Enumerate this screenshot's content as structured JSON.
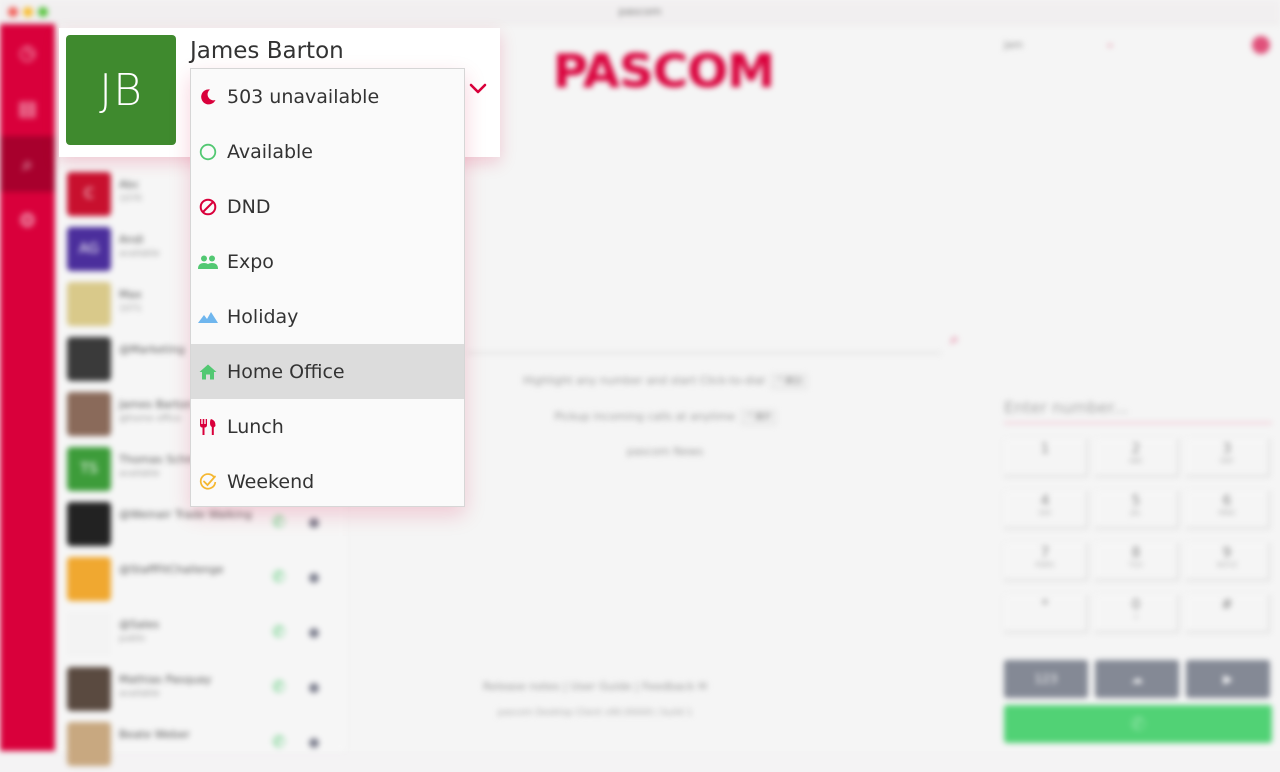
{
  "window": {
    "title": "pascom",
    "traffic_lights": [
      "#f25f58",
      "#f9bd2e",
      "#56c43c"
    ]
  },
  "sidebar": {
    "items": [
      {
        "name": "dashboard",
        "icon": "clock-icon"
      },
      {
        "name": "contacts",
        "icon": "address-card-icon"
      },
      {
        "name": "search",
        "icon": "search-icon",
        "active": true
      },
      {
        "name": "settings",
        "icon": "gear-icon"
      }
    ]
  },
  "user": {
    "initials": "JB",
    "name": "James Barton",
    "avatar_color": "#3f8a2e"
  },
  "status_dropdown": {
    "options": [
      {
        "label": "503 unavailable",
        "icon": "moon-icon",
        "color": "#d9003b"
      },
      {
        "label": "Available",
        "icon": "circle-outline-icon",
        "color": "#52c872"
      },
      {
        "label": "DND",
        "icon": "prohibited-icon",
        "color": "#d9003b"
      },
      {
        "label": "Expo",
        "icon": "people-icon",
        "color": "#52c872"
      },
      {
        "label": "Holiday",
        "icon": "mountain-icon",
        "color": "#6fb6ee"
      },
      {
        "label": "Home Office",
        "icon": "home-icon",
        "color": "#52c872",
        "highlighted": true
      },
      {
        "label": "Lunch",
        "icon": "cutlery-icon",
        "color": "#d9003b"
      },
      {
        "label": "Weekend",
        "icon": "check-circle-icon",
        "color": "#f5b730"
      }
    ]
  },
  "contacts": [
    {
      "initials": "C",
      "name": "Abc",
      "sub": "1070",
      "color": "#c8102e"
    },
    {
      "initials": "AG",
      "name": "Andi",
      "sub": "available",
      "color": "#4b2e9c"
    },
    {
      "initials": "",
      "name": "Max",
      "sub": "1071",
      "color": "#d9c98a"
    },
    {
      "initials": "",
      "name": "@Marketing",
      "sub": "",
      "color": "#3a3a3a"
    },
    {
      "initials": "",
      "name": "James Barton",
      "sub": "@home office",
      "color": "#8a6a5a"
    },
    {
      "initials": "TS",
      "name": "Thomas Schmidt",
      "sub": "available",
      "color": "#3d9c3a"
    },
    {
      "initials": "",
      "name": "@Weinair Trade Walking",
      "sub": "",
      "color": "#222"
    },
    {
      "initials": "",
      "name": "@StaffFitChallenge",
      "sub": "",
      "color": "#f0a830"
    },
    {
      "initials": "",
      "name": "@Sales",
      "sub": "public",
      "color": "#f3f3f3"
    },
    {
      "initials": "",
      "name": "Mathias Pasquay",
      "sub": "available",
      "color": "#5a4a40"
    },
    {
      "initials": "",
      "name": "Beate Weber",
      "sub": "",
      "color": "#c8a880"
    }
  ],
  "main": {
    "logo": "PASCOM",
    "hints": [
      {
        "text": "Highlight any number and start Click-to-dial",
        "key": "⌃⌘D"
      },
      {
        "text": "Pickup incoming calls at anytime",
        "key": "⌃⌘P"
      },
      {
        "text": "pascom News",
        "key": ""
      }
    ],
    "footer_links": "Release notes  |  User Guide  |  Feedback ✉",
    "footer_version": "pascom Desktop Client v90.00000 / build 1"
  },
  "right_panel": {
    "user_label": "Jam",
    "number_placeholder": "Enter number...",
    "keys": [
      {
        "digit": "1",
        "letters": ""
      },
      {
        "digit": "2",
        "letters": "ABC"
      },
      {
        "digit": "3",
        "letters": "DEF"
      },
      {
        "digit": "4",
        "letters": "GHI"
      },
      {
        "digit": "5",
        "letters": "JKL"
      },
      {
        "digit": "6",
        "letters": "MNO"
      },
      {
        "digit": "7",
        "letters": "PQRS"
      },
      {
        "digit": "8",
        "letters": "TUV"
      },
      {
        "digit": "9",
        "letters": "WXYZ"
      },
      {
        "digit": "*",
        "letters": ""
      },
      {
        "digit": "0",
        "letters": "+"
      },
      {
        "digit": "#",
        "letters": ""
      }
    ],
    "action_buttons": [
      "123",
      "☁",
      "▶"
    ],
    "call_icon": "✆"
  }
}
